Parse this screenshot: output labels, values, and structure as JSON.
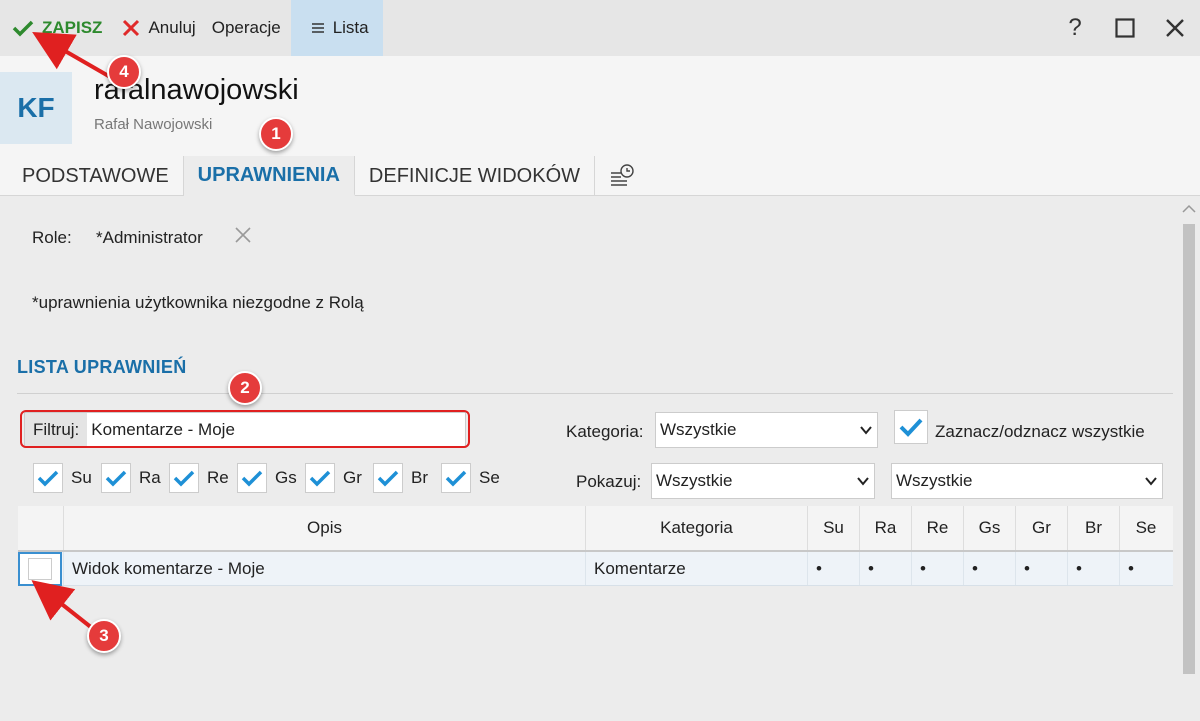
{
  "toolbar": {
    "save_label": "ZAPISZ",
    "cancel_label": "Anuluj",
    "operations_label": "Operacje",
    "list_label": "Lista",
    "help_label": "?"
  },
  "header": {
    "avatar_initials": "KF",
    "login": "rafalnawojowski",
    "full_name": "Rafał Nawojowski"
  },
  "tabs": [
    {
      "label": "PODSTAWOWE",
      "active": false
    },
    {
      "label": "UPRAWNIENIA",
      "active": true
    },
    {
      "label": "DEFINICJE WIDOKÓW",
      "active": false
    }
  ],
  "role": {
    "label": "Role:",
    "value": "*Administrator"
  },
  "note": "*uprawnienia użytkownika niezgodne z Rolą",
  "section_title": "LISTA UPRAWNIEŃ",
  "filter": {
    "label": "Filtruj:",
    "value": "Komentarze - Moje"
  },
  "category": {
    "label": "Kategoria:",
    "selected": "Wszystkie"
  },
  "select_all_label": "Zaznacz/odznacz wszystkie",
  "flags": [
    "Su",
    "Ra",
    "Re",
    "Gs",
    "Gr",
    "Br",
    "Se"
  ],
  "show": {
    "label": "Pokazuj:",
    "selected_1": "Wszystkie",
    "selected_2": "Wszystkie"
  },
  "table": {
    "headers": {
      "opis": "Opis",
      "kategoria": "Kategoria",
      "flags": [
        "Su",
        "Ra",
        "Re",
        "Gs",
        "Gr",
        "Br",
        "Se"
      ]
    },
    "rows": [
      {
        "opis": "Widok komentarze - Moje",
        "kategoria": "Komentarze",
        "checked": false,
        "flags": [
          "•",
          "•",
          "•",
          "•",
          "•",
          "•",
          "•"
        ]
      }
    ]
  },
  "annotations": [
    "1",
    "2",
    "3",
    "4"
  ],
  "colors": {
    "accent": "#1a6fa8",
    "save_green": "#2e8a2e",
    "check_blue": "#1e90d6",
    "annotation_red": "#e53b3b"
  }
}
